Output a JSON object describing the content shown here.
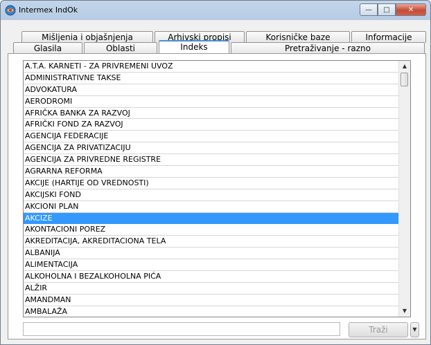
{
  "window": {
    "title": "Intermex IndOk"
  },
  "tabs_row1": [
    "Mišljenia i objašnjenja",
    "Arhivski propisi",
    "Korisničke baze",
    "Informacije"
  ],
  "tabs_row2": [
    "Glasila",
    "Oblasti",
    "Indeks",
    "Pretraživanje - razno"
  ],
  "active_tab": "Indeks",
  "list": {
    "items": [
      "A.T.A. KARNETI - ZA PRIVREMENI UVOZ",
      "ADMINISTRATIVNE TAKSE",
      "ADVOKATURA",
      "AERODROMI",
      "AFRIČKA BANKA ZA RAZVOJ",
      "AFRIČKI FOND ZA RAZVOJ",
      "AGENCIJA FEDERACIJE",
      "AGENCIJA ZA PRIVATIZACIJU",
      "AGENCIJA ZA PRIVREDNE REGISTRE",
      "AGRARNA REFORMA",
      "AKCIJE (HARTIJE OD VREDNOSTI)",
      "AKCIJSKI FOND",
      "AKCIONI PLAN",
      "AKCIZE",
      "AKONTACIONI POREZ",
      "AKREDITACIJA, AKREDITACIONA TELA",
      "ALBANIJA",
      "ALIMENTACIJA",
      "ALKOHOLNA I BEZALKOHOLNA PIĆA",
      "ALŽIR",
      "AMANDMAN",
      "AMBALAŽA"
    ],
    "selected_index": 13
  },
  "search": {
    "value": "",
    "button_label": "Traži"
  },
  "icons": {
    "scroll_up": "▲",
    "scroll_down": "▼",
    "dropdown": "▼",
    "minimize": "—",
    "maximize": "□",
    "close": "✕"
  },
  "colors": {
    "selection": "#3399ff",
    "active_tab_accent": "#4a8ed6"
  }
}
